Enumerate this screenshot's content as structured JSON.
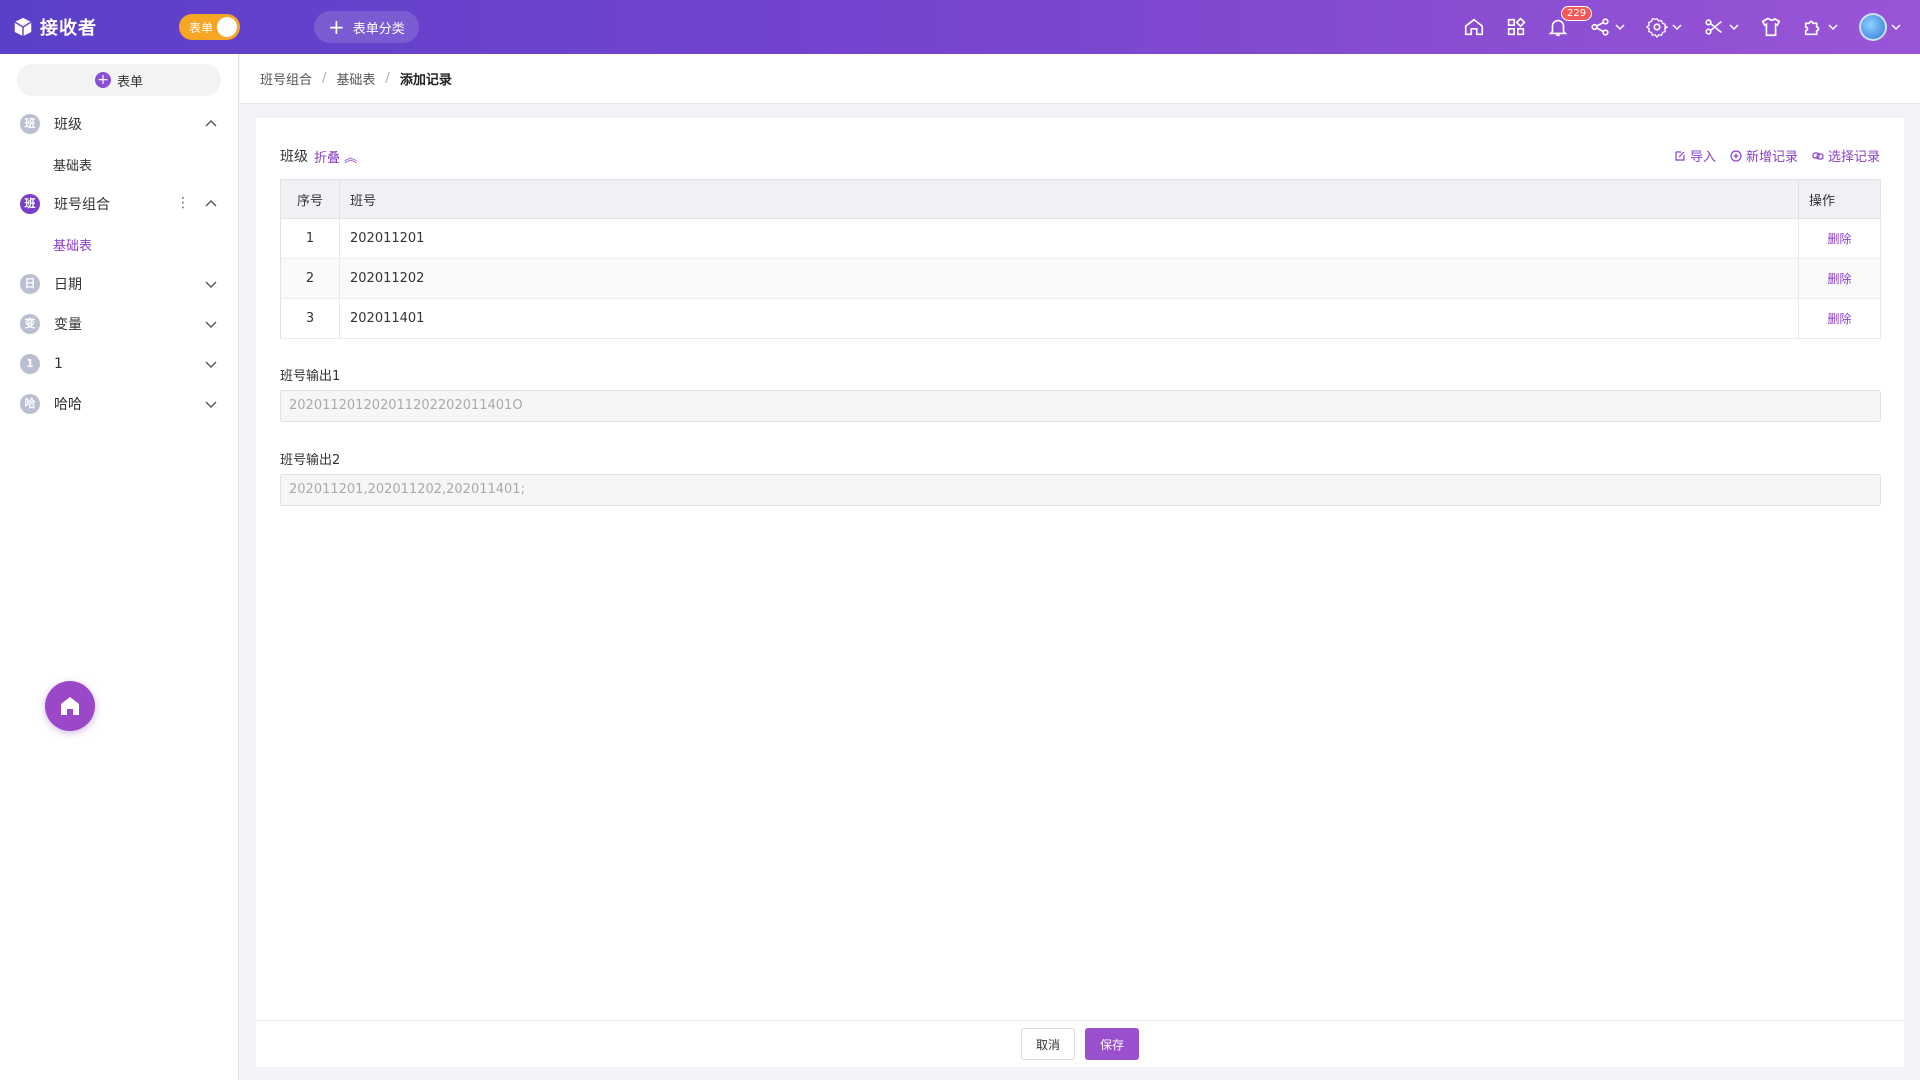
{
  "app": {
    "name": "接收者",
    "mode_toggle_label": "表单",
    "category_button": "表单分类",
    "notification_count": "229"
  },
  "sidebar": {
    "new_form_label": "表单",
    "groups": [
      {
        "icon_char": "班",
        "label": "班级",
        "expanded": true,
        "children": [
          "基础表"
        ]
      },
      {
        "icon_char": "班",
        "label": "班号组合",
        "expanded": true,
        "active": true,
        "children": [
          "基础表"
        ]
      },
      {
        "icon_char": "日",
        "label": "日期",
        "expanded": false
      },
      {
        "icon_char": "变",
        "label": "变量",
        "expanded": false
      },
      {
        "icon_char": "1",
        "label": "1",
        "expanded": false
      },
      {
        "icon_char": "哈",
        "label": "哈哈",
        "expanded": false
      }
    ]
  },
  "breadcrumb": [
    "班号组合",
    "基础表",
    "添加记录"
  ],
  "section": {
    "title": "班级",
    "fold_label": "折叠",
    "actions": {
      "import": "导入",
      "add": "新增记录",
      "select": "选择记录"
    }
  },
  "table": {
    "headers": {
      "index": "序号",
      "class_no": "班号",
      "ops": "操作"
    },
    "rows": [
      {
        "index": "1",
        "class_no": "202011201",
        "op": "删除"
      },
      {
        "index": "2",
        "class_no": "202011202",
        "op": "删除"
      },
      {
        "index": "3",
        "class_no": "202011401",
        "op": "删除"
      }
    ]
  },
  "fields": {
    "output1": {
      "label": "班号输出1",
      "value": "202011201202011202202011401O"
    },
    "output2": {
      "label": "班号输出2",
      "value": "202011201,202011202,202011401;"
    }
  },
  "footer": {
    "cancel": "取消",
    "save": "保存"
  },
  "colors": {
    "accent": "#8a3fc8",
    "header_start": "#5b3fc9",
    "header_end": "#9a55d6",
    "toggle": "#f5a623"
  }
}
